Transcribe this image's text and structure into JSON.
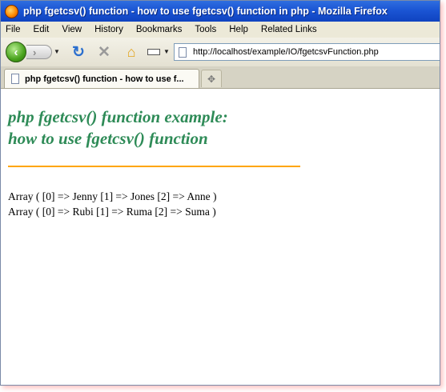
{
  "window": {
    "title": "php fgetcsv() function - how to use fgetcsv() function in php - Mozilla Firefox"
  },
  "menu": {
    "items": [
      "File",
      "Edit",
      "View",
      "History",
      "Bookmarks",
      "Tools",
      "Help",
      "Related Links"
    ]
  },
  "nav": {
    "url": "http://localhost/example/IO/fgetcsvFunction.php",
    "icons": [
      "back-arrow",
      "forward-arrow",
      "reload",
      "stop",
      "home",
      "bookmark-menu",
      "page"
    ]
  },
  "tabs": [
    {
      "label": "php fgetcsv() function - how to use f..."
    }
  ],
  "page": {
    "heading_line1": "php fgetcsv() function example:",
    "heading_line2": "how to use fgetcsv() function",
    "heading_color": "#2e8b57",
    "rule_color": "#ffa500",
    "output_lines": [
      "Array ( [0] => Jenny [1] => Jones [2] => Anne )",
      "Array ( [0] => Rubi [1] => Ruma [2] => Suma )"
    ]
  }
}
